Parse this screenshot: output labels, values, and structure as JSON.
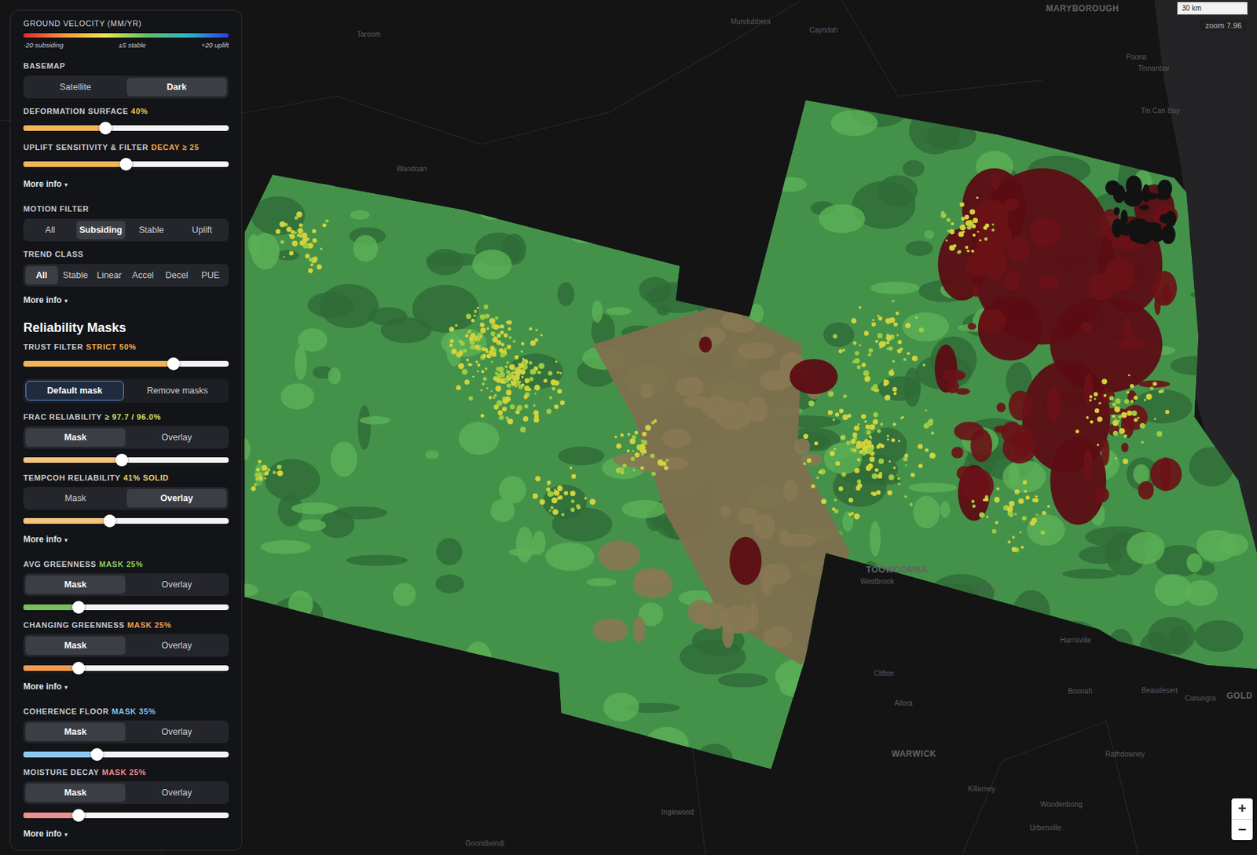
{
  "legend": {
    "title": "GROUND VELOCITY (MM/YR)",
    "min_label": "-20 subsiding",
    "mid_label": "±5 stable",
    "max_label": "+20 uplift"
  },
  "sidebar": {
    "controls": [
      {
        "kind": "toggle",
        "label": "BASEMAP",
        "options": [
          {
            "label": "Satellite",
            "selected": false
          },
          {
            "label": "Dark",
            "selected": true
          }
        ]
      },
      {
        "kind": "slider",
        "label": "DEFORMATION SURFACE",
        "value": "40%",
        "value_color": "#f5c451",
        "level": 0.4,
        "color": "#f3b455"
      },
      {
        "kind": "slider",
        "label": "UPLIFT SENSITIVITY & FILTER",
        "value": "DECAY ≥ 25",
        "value_color": "#f5a54c",
        "level": 0.5,
        "color": "#f3b455"
      },
      {
        "kind": "link",
        "text": "More info",
        "caret": "▾"
      },
      {
        "kind": "toggle",
        "label": "MOTION FILTER",
        "options": [
          {
            "label": "All",
            "selected": false
          },
          {
            "label": "Subsiding",
            "selected": true
          },
          {
            "label": "Stable",
            "selected": false
          },
          {
            "label": "Uplift",
            "selected": false
          }
        ]
      },
      {
        "kind": "toggle",
        "label": "TREND CLASS",
        "options": [
          {
            "label": "All",
            "selected": true
          },
          {
            "label": "Stable",
            "selected": false
          },
          {
            "label": "Linear",
            "selected": false
          },
          {
            "label": "Accel",
            "selected": false
          },
          {
            "label": "Decel",
            "selected": false
          },
          {
            "label": "PUE",
            "selected": false
          }
        ]
      },
      {
        "kind": "link",
        "text": "More info",
        "caret": "▾"
      },
      {
        "kind": "heading",
        "text": "Reliability Masks"
      },
      {
        "kind": "slider",
        "label": "TRUST FILTER",
        "value": "STRICT 50%",
        "value_color": "#f5b04e",
        "level": 0.73,
        "color": "#f3b455"
      },
      {
        "kind": "buttons",
        "options": [
          {
            "label": "Default mask",
            "selected": true
          },
          {
            "label": "Remove masks",
            "selected": false
          }
        ]
      },
      {
        "kind": "mask",
        "label": "FRAC RELIABILITY",
        "value": "≥ 97.7 / 96.0%",
        "value_color": "#d6e26a",
        "options": [
          {
            "label": "Mask",
            "selected": true
          },
          {
            "label": "Overlay",
            "selected": false
          }
        ],
        "level": 0.48,
        "color": "#f2c47c"
      },
      {
        "kind": "mask",
        "label": "TEMPCOH RELIABILITY",
        "value": "41% SOLID",
        "value_color": "#e7d46c",
        "options": [
          {
            "label": "Mask",
            "selected": false
          },
          {
            "label": "Overlay",
            "selected": true
          }
        ],
        "level": 0.42,
        "color": "#f2c47c"
      },
      {
        "kind": "link",
        "text": "More info",
        "caret": "▾"
      },
      {
        "kind": "mask",
        "label": "AVG GREENNESS",
        "value": "MASK 25%",
        "value_color": "#8fd05c",
        "options": [
          {
            "label": "Mask",
            "selected": true
          },
          {
            "label": "Overlay",
            "selected": false
          }
        ],
        "level": 0.27,
        "color": "#78c05a"
      },
      {
        "kind": "mask",
        "label": "CHANGING GREENNESS",
        "value": "MASK 25%",
        "value_color": "#f0a050",
        "options": [
          {
            "label": "Mask",
            "selected": true
          },
          {
            "label": "Overlay",
            "selected": false
          }
        ],
        "level": 0.27,
        "color": "#ee9a50"
      },
      {
        "kind": "link",
        "text": "More info",
        "caret": "▾"
      },
      {
        "kind": "mask",
        "label": "COHERENCE FLOOR",
        "value": "MASK 35%",
        "value_color": "#7cc8f2",
        "options": [
          {
            "label": "Mask",
            "selected": true
          },
          {
            "label": "Overlay",
            "selected": false
          }
        ],
        "level": 0.36,
        "color": "#8cc8ee"
      },
      {
        "kind": "mask",
        "label": "MOISTURE DECAY",
        "value": "MASK 25%",
        "value_color": "#f28b8b",
        "options": [
          {
            "label": "Mask",
            "selected": true
          },
          {
            "label": "Overlay",
            "selected": false
          }
        ],
        "level": 0.27,
        "color": "#ef8f8f"
      },
      {
        "kind": "link",
        "text": "More info",
        "caret": "▾"
      }
    ]
  },
  "map": {
    "scale": "30 km",
    "zoom": "zoom 7.96",
    "zoom_in": "+",
    "zoom_out": "−",
    "labels": [
      {
        "text": "Taroom"
      },
      {
        "text": "Wandoan"
      },
      {
        "text": "Mundubbera"
      },
      {
        "text": "Cayndah"
      },
      {
        "text": "MARYBOROUGH"
      },
      {
        "text": "Poona"
      },
      {
        "text": "Tinnanbar"
      },
      {
        "text": "Tin Can Bay"
      },
      {
        "text": "TOOWOOMBA"
      },
      {
        "text": "Westbrook"
      },
      {
        "text": "Laidley"
      },
      {
        "text": "Clifton"
      },
      {
        "text": "Harrisville"
      },
      {
        "text": "Allora"
      },
      {
        "text": "Boonah"
      },
      {
        "text": "Beaudesert"
      },
      {
        "text": "Canungra"
      },
      {
        "text": "GOLD"
      },
      {
        "text": "WARWICK"
      },
      {
        "text": "Rathdowney"
      },
      {
        "text": "Killarney"
      },
      {
        "text": "Woodenbong"
      },
      {
        "text": "Urbenville"
      },
      {
        "text": "Inglewood"
      },
      {
        "text": "Goondiwindi"
      }
    ]
  }
}
